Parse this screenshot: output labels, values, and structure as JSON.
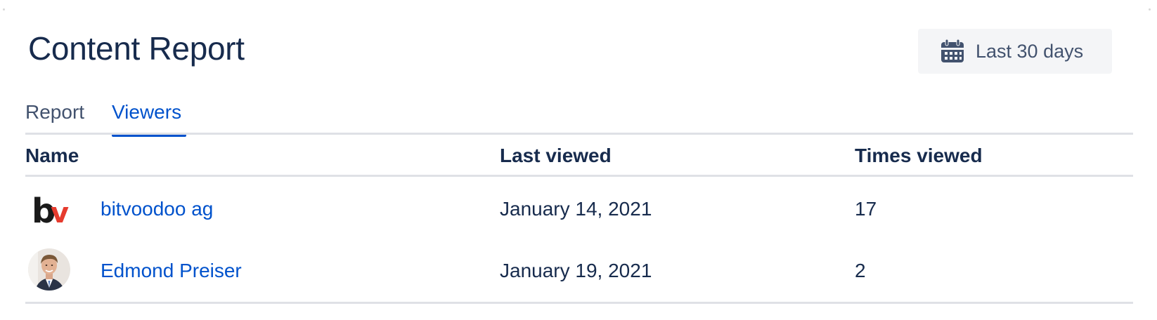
{
  "header": {
    "title": "Content Report"
  },
  "date_filter": {
    "label": "Last 30 days",
    "icon": "calendar-icon"
  },
  "tabs": [
    {
      "label": "Report",
      "active": false
    },
    {
      "label": "Viewers",
      "active": true
    }
  ],
  "table": {
    "columns": [
      "Name",
      "Last viewed",
      "Times viewed"
    ],
    "rows": [
      {
        "name": "bitvoodoo ag",
        "avatar": "bitvoodoo-logo",
        "last_viewed": "January 14, 2021",
        "times_viewed": "17"
      },
      {
        "name": "Edmond Preiser",
        "avatar": "user-photo",
        "last_viewed": "January 19, 2021",
        "times_viewed": "2"
      }
    ]
  },
  "logo_text": {
    "b": "b",
    "v": "v"
  },
  "colors": {
    "link": "#0052cc",
    "text": "#172b4d",
    "muted": "#42526e",
    "divider": "#dfe1e6",
    "button_bg": "#f4f5f7",
    "logo_dark": "#1a1a1a",
    "logo_red": "#e63b2e"
  }
}
